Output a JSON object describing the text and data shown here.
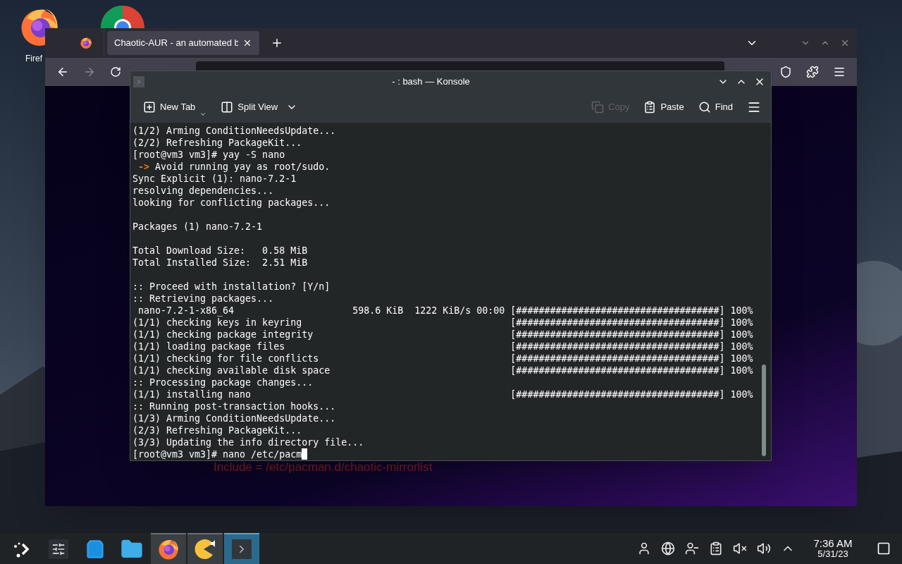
{
  "desktop_icons": [
    {
      "kind": "firefox",
      "label": "Firef"
    },
    {
      "kind": "chrome"
    }
  ],
  "browser": {
    "tabs": [
      {
        "title": "Chaotic-AUR - an automated b",
        "selected": true
      }
    ],
    "page_text": "Include = /etc/pacman.d/chaotic-mirrorlist"
  },
  "konsole": {
    "title": "- : bash — Konsole",
    "toolbar": [
      {
        "kind": "new-tab",
        "label": "New Tab",
        "disabled": false
      },
      {
        "kind": "split",
        "label": "Split View",
        "disabled": false
      },
      {
        "kind": "copy",
        "label": "Copy",
        "disabled": true
      },
      {
        "kind": "paste",
        "label": "Paste",
        "disabled": false
      },
      {
        "kind": "find",
        "label": "Find",
        "disabled": false
      }
    ],
    "blocks": [
      [
        {
          "text": "(1/2) Arming ConditionNeedsUpdate..."
        },
        {
          "text": "(2/2) Refreshing PackageKit..."
        },
        {
          "text": "[root@vm3 vm3]# yay -S nano"
        },
        {
          "arrow": " ->",
          "text": " Avoid running yay as root/sudo."
        },
        {
          "text": "Sync Explicit (1): nano-7.2-1"
        },
        {
          "text": "resolving dependencies..."
        },
        {
          "text": "looking for conflicting packages..."
        }
      ],
      [
        {
          "text": "Packages (1) nano-7.2-1"
        }
      ],
      [
        {
          "text": "Total Download Size:   0.58 MiB"
        },
        {
          "text": "Total Installed Size:  2.51 MiB"
        }
      ],
      [
        {
          "text": ":: Proceed with installation? [Y/n]"
        },
        {
          "text": ":: Retrieving packages..."
        },
        {
          "text": " nano-7.2-1-x86_64                     598.6 KiB  1222 KiB/s 00:00 [####################################] 100%"
        },
        {
          "text": "(1/1) checking keys in keyring                                     [####################################] 100%"
        },
        {
          "text": "(1/1) checking package integrity                                   [####################################] 100%"
        },
        {
          "text": "(1/1) loading package files                                        [####################################] 100%"
        },
        {
          "text": "(1/1) checking for file conflicts                                  [####################################] 100%"
        },
        {
          "text": "(1/1) checking available disk space                                [####################################] 100%"
        },
        {
          "text": ":: Processing package changes..."
        },
        {
          "text": "(1/1) installing nano                                              [####################################] 100%"
        },
        {
          "text": ":: Running post-transaction hooks..."
        },
        {
          "text": "(1/3) Arming ConditionNeedsUpdate..."
        },
        {
          "text": "(2/3) Refreshing PackageKit..."
        },
        {
          "text": "(3/3) Updating the info directory file..."
        },
        {
          "text": "[root@vm3 vm3]# nano /etc/pacm",
          "cursor": true
        }
      ]
    ]
  },
  "taskbar": {
    "items": [
      {
        "kind": "launcher",
        "selected": false
      },
      {
        "kind": "settings",
        "selected": false
      },
      {
        "kind": "store",
        "selected": false
      },
      {
        "kind": "folder",
        "selected": false
      },
      {
        "kind": "firefox",
        "selected": false,
        "open": true
      },
      {
        "kind": "pacman",
        "selected": false,
        "open": true
      },
      {
        "kind": "konsole",
        "selected": true,
        "open": true
      }
    ],
    "tray": [
      {
        "kind": "user"
      },
      {
        "kind": "network"
      },
      {
        "kind": "user-status"
      },
      {
        "kind": "clipboard"
      },
      {
        "kind": "mic-muted"
      },
      {
        "kind": "volume"
      },
      {
        "kind": "expand"
      }
    ],
    "time": "7:36 AM",
    "date": "5/31/23"
  }
}
